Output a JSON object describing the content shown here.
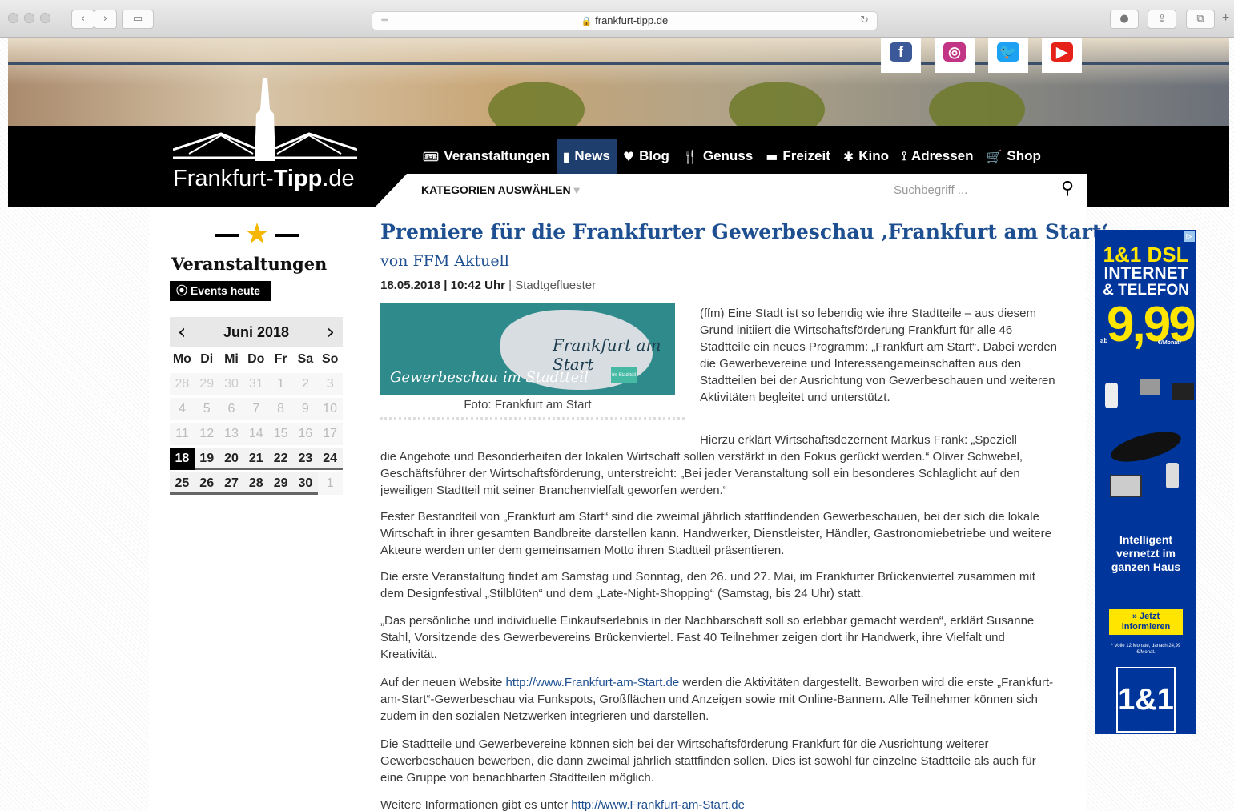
{
  "browser": {
    "url": "frankfurt-tipp.de",
    "back": "‹",
    "forward": "›"
  },
  "header": {
    "logo_prefix": "Frankfurt-",
    "logo_bold": "Tipp",
    "logo_suffix": ".de",
    "social": [
      {
        "name": "facebook",
        "label": "f",
        "color": "#3b5998"
      },
      {
        "name": "instagram",
        "label": "◎",
        "color": "#c13584"
      },
      {
        "name": "twitter",
        "label": "🐦",
        "color": "#1da1f2"
      },
      {
        "name": "youtube",
        "label": "▶",
        "color": "#e62117"
      }
    ],
    "nav": [
      {
        "icon": "ticket-icon",
        "label": "Veranstaltungen"
      },
      {
        "icon": "bookmark-icon",
        "label": "News"
      },
      {
        "icon": "heart-icon",
        "label": "Blog"
      },
      {
        "icon": "fork-knife-icon",
        "label": "Genuss"
      },
      {
        "icon": "ticket2-icon",
        "label": "Freizeit"
      },
      {
        "icon": "film-icon",
        "label": "Kino"
      },
      {
        "icon": "pin-icon",
        "label": "Adressen"
      },
      {
        "icon": "cart-icon",
        "label": "Shop"
      }
    ],
    "category_label": "KATEGORIEN AUSWÄHLEN",
    "search_placeholder": "Suchbegriff ..."
  },
  "sidebar": {
    "title": "Veranstaltungen",
    "events_button": "⦿ Events heute",
    "calendar": {
      "month": "Juni 2018",
      "weekdays": [
        "Mo",
        "Di",
        "Mi",
        "Do",
        "Fr",
        "Sa",
        "So"
      ],
      "weeks": [
        [
          "28",
          "29",
          "30",
          "31",
          "1",
          "2",
          "3"
        ],
        [
          "4",
          "5",
          "6",
          "7",
          "8",
          "9",
          "10"
        ],
        [
          "11",
          "12",
          "13",
          "14",
          "15",
          "16",
          "17"
        ],
        [
          "18",
          "19",
          "20",
          "21",
          "22",
          "23",
          "24"
        ],
        [
          "25",
          "26",
          "27",
          "28",
          "29",
          "30",
          "1"
        ]
      ],
      "today": "18"
    }
  },
  "article": {
    "title": "Premiere für die Frankfurter Gewerbeschau ‚Frankfurt am Start‘",
    "byline": "von FFM Aktuell",
    "date": "18.05.2018 | 10:42 Uhr",
    "sep": " | ",
    "category": "Stadtgefluester",
    "image_brand": "Frankfurt am Start",
    "image_sub": "Gewerbeschau im Stadtteil",
    "image_tag": "Im Stadtteil",
    "caption": "Foto: Frankfurt am Start",
    "p1": "(ffm) Eine Stadt ist so lebendig wie ihre Stadtteile – aus diesem Grund initiiert die Wirtschaftsförderung Frankfurt für alle 46 Stadtteile ein neues Programm: „Frankfurt am Start“. Dabei werden die Gewerbevereine und Interessengemeinschaften aus den Stadtteilen bei der Ausrichtung von Gewerbeschauen und weiteren Aktivitäten begleitet und unterstützt.",
    "p2a": "Hierzu erklärt Wirtschaftsdezernent Markus Frank: „Speziell",
    "p2b": "die Angebote und Besonderheiten der lokalen Wirtschaft sollen verstärkt in den Fokus gerückt werden.“ Oliver Schwebel, Geschäftsführer der Wirtschaftsförderung, unterstreicht: „Bei jeder Veranstaltung soll ein besonderes Schlaglicht auf den jeweiligen Stadtteil mit seiner Branchenvielfalt geworfen werden.“",
    "p3": "Fester Bestandteil von „Frankfurt am Start“ sind die zweimal jährlich stattfindenden Gewerbeschauen, bei der sich die lokale Wirtschaft in ihrer gesamten Bandbreite darstellen kann. Handwerker, Dienstleister, Händler, Gastronomiebetriebe und weitere Akteure werden unter dem gemeinsamen Motto ihren Stadtteil präsentieren.",
    "p4": "Die erste Veranstaltung findet am Samstag und Sonntag, den 26. und 27. Mai, im Frankfurter Brückenviertel zusammen mit dem Designfestival „Stilblüten“ und dem „Late-Night-Shopping“ (Samstag, bis 24 Uhr) statt.",
    "p5": "„Das persönliche und individuelle Einkaufserlebnis in der Nachbarschaft soll so erlebbar gemacht werden“, erklärt Susanne Stahl, Vorsitzende des Gewerbevereins Brückenviertel. Fast 40 Teilnehmer zeigen dort ihr Handwerk, ihre Vielfalt und Kreativität.",
    "p6_pre": "Auf der neuen Website ",
    "p6_link": "http://www.Frankfurt-am-Start.de",
    "p6_post": " werden die Aktivitäten dargestellt. Beworben wird die erste „Frankfurt-am-Start“-Gewerbeschau via Funkspots, Großflächen und Anzeigen sowie mit Online-Bannern. Alle Teilnehmer können sich zudem in den sozialen Netzwerken integrieren und darstellen.",
    "p7": "Die Stadtteile und Gewerbevereine können sich bei der Wirtschaftsförderung Frankfurt für die Ausrichtung weiterer Gewerbeschauen bewerben, die dann zweimal jährlich stattfinden sollen. Dies ist sowohl für einzelne Stadtteile als auch für eine Gruppe von benachbarten Stadtteilen möglich.",
    "p8_pre": "Weitere Informationen gibt es unter ",
    "p8_link": "http://www.Frankfurt-am-Start.de"
  },
  "ad": {
    "l1": "1&1 DSL",
    "l2": "INTERNET",
    "l3": "& TELEFON",
    "ab": "ab",
    "price": "9,99",
    "per": "€/Monat*",
    "tag1": "Intelligent",
    "tag2": "vernetzt im",
    "tag3": "ganzen Haus",
    "cta": "» Jetzt informieren",
    "fine": "* Volle 12 Monate, danach 24,99 €/Monat.",
    "brand": "1&1",
    "badge": "▷"
  }
}
